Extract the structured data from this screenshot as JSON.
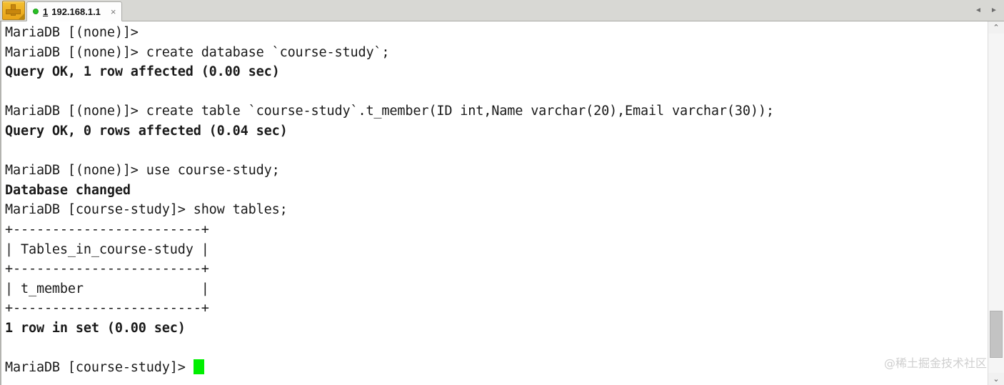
{
  "window": {
    "newtab_button_label": "+",
    "nav_prev_icon": "◄",
    "nav_next_icon": "►"
  },
  "tabs": [
    {
      "index": "1",
      "title": "192.168.1.1",
      "close_label": "×",
      "status": "connected",
      "status_color": "#27c024"
    }
  ],
  "terminal": {
    "background_color": "#ffffff",
    "text_color": "#1a1a1a",
    "cursor_color": "#00ef00",
    "lines": [
      {
        "text": "MariaDB [(none)]>",
        "bold": false
      },
      {
        "text": "MariaDB [(none)]> create database `course-study`;",
        "bold": false
      },
      {
        "text": "Query OK, 1 row affected (0.00 sec)",
        "bold": true
      },
      {
        "text": "",
        "bold": false
      },
      {
        "text": "MariaDB [(none)]> create table `course-study`.t_member(ID int,Name varchar(20),Email varchar(30));",
        "bold": false
      },
      {
        "text": "Query OK, 0 rows affected (0.04 sec)",
        "bold": true
      },
      {
        "text": "",
        "bold": false
      },
      {
        "text": "MariaDB [(none)]> use course-study;",
        "bold": false
      },
      {
        "text": "Database changed",
        "bold": true
      },
      {
        "text": "MariaDB [course-study]> show tables;",
        "bold": false
      },
      {
        "text": "+------------------------+",
        "bold": false
      },
      {
        "text": "| Tables_in_course-study |",
        "bold": false
      },
      {
        "text": "+------------------------+",
        "bold": false
      },
      {
        "text": "| t_member               |",
        "bold": false
      },
      {
        "text": "+------------------------+",
        "bold": false
      },
      {
        "text": "1 row in set (0.00 sec)",
        "bold": true
      },
      {
        "text": "",
        "bold": false
      },
      {
        "text": "MariaDB [course-study]> ",
        "bold": false,
        "cursor": true
      }
    ]
  },
  "scrollbar": {
    "up_icon": "⌃",
    "down_icon": "⌄"
  },
  "watermark": {
    "text": "@稀土掘金技术社区"
  }
}
